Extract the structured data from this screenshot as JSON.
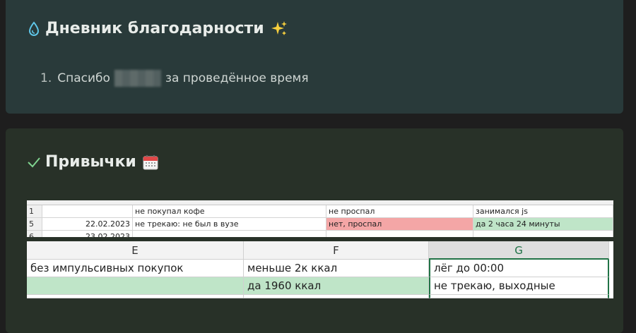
{
  "gratitude": {
    "title": "Дневник благодарности",
    "items": [
      {
        "number": "1.",
        "prefix": "Спасибо",
        "suffix": "за проведённое время"
      }
    ]
  },
  "habits": {
    "title": "Привычки",
    "sheet_small": {
      "rows": [
        {
          "row": "1",
          "date": "",
          "c1": "не покупал кофе",
          "c2": "не проспал",
          "c3": "занимался js"
        },
        {
          "row": "5",
          "date": "22.02.2023",
          "c1": "не трекаю: не был в вузе",
          "c2": "нет, проспал",
          "c3": "да 2 часа 24 минуты"
        },
        {
          "row": "6",
          "date": "23.02.2023",
          "c1": "",
          "c2": "",
          "c3": ""
        }
      ]
    },
    "sheet_large": {
      "columns": [
        "E",
        "F",
        "G"
      ],
      "rows": [
        [
          "без импульсивных покупок",
          "меньше 2к ккал",
          "лёг до 00:00"
        ],
        [
          "",
          "да 1960 ккал",
          "не трекаю, выходные"
        ]
      ]
    }
  },
  "colors": {
    "accent_green": "#217346",
    "cell_green": "#bfe5c8",
    "cell_red": "#f4a6a6"
  }
}
